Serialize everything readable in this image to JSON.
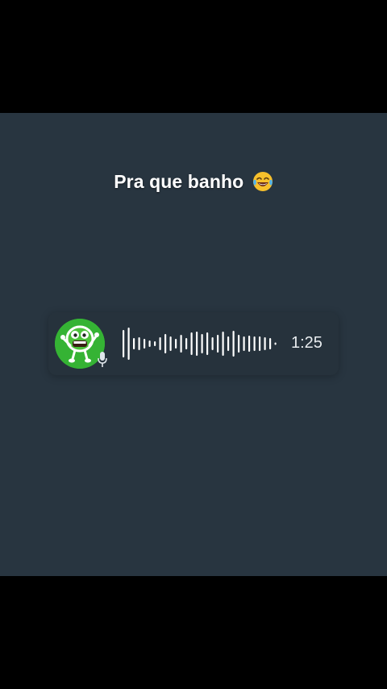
{
  "caption": {
    "text": "Pra que banho",
    "emoji_icon": "face-with-tears-of-joy-icon"
  },
  "voice_message": {
    "duration": "1:25",
    "avatar_icon": "green-monster-sticker-avatar",
    "mic_icon": "microphone-icon",
    "waveform_levels": [
      0.85,
      1.0,
      0.35,
      0.4,
      0.3,
      0.2,
      0.15,
      0.4,
      0.6,
      0.45,
      0.3,
      0.55,
      0.35,
      0.7,
      0.75,
      0.6,
      0.7,
      0.4,
      0.55,
      0.75,
      0.45,
      0.8,
      0.55,
      0.45,
      0.5,
      0.45,
      0.45,
      0.4,
      0.35,
      0.05
    ]
  },
  "colors": {
    "page_background": "#000000",
    "content_background": "#283540",
    "bubble_background": "#26323c",
    "avatar_green": "#35b334",
    "waveform": "#ffffff",
    "text": "#ffffff"
  }
}
